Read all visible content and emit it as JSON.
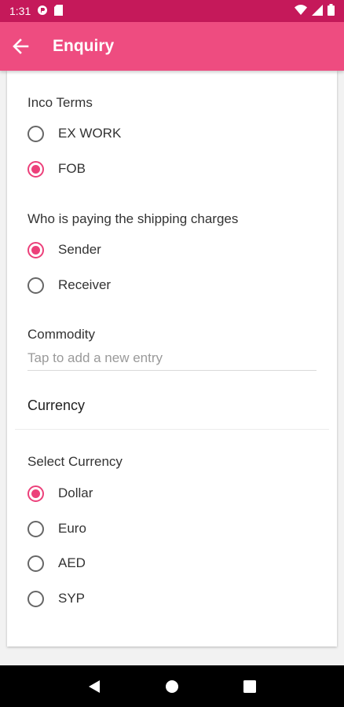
{
  "status_bar": {
    "time": "1:31"
  },
  "app_bar": {
    "title": "Enquiry"
  },
  "inco_terms": {
    "label": "Inco Terms",
    "options": [
      {
        "label": "EX WORK",
        "checked": false
      },
      {
        "label": "FOB",
        "checked": true
      }
    ]
  },
  "shipping": {
    "label": "Who is paying the shipping charges",
    "options": [
      {
        "label": "Sender",
        "checked": true
      },
      {
        "label": "Receiver",
        "checked": false
      }
    ]
  },
  "commodity": {
    "label": "Commodity",
    "placeholder": "Tap to add a new entry"
  },
  "currency": {
    "header": "Currency",
    "select_label": "Select Currency",
    "options": [
      {
        "label": "Dollar",
        "checked": true
      },
      {
        "label": "Euro",
        "checked": false
      },
      {
        "label": "AED",
        "checked": false
      },
      {
        "label": "SYP",
        "checked": false
      }
    ]
  },
  "colors": {
    "status_bar": "#c5195a",
    "app_bar": "#ee4c80",
    "accent": "#ec407a"
  },
  "icons": {
    "back": "arrow-left-icon",
    "nav_back": "triangle-back-icon",
    "nav_home": "circle-home-icon",
    "nav_recents": "square-recents-icon"
  }
}
